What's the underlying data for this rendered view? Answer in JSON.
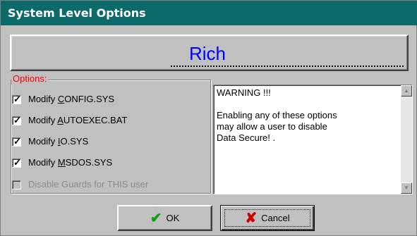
{
  "window": {
    "title": "System Level Options"
  },
  "user": {
    "name": "Rich"
  },
  "options": {
    "legend": "Options:",
    "items": [
      {
        "pre": "Modify ",
        "key": "C",
        "post": "ONFIG.SYS",
        "checked": true,
        "enabled": true
      },
      {
        "pre": "Modify ",
        "key": "A",
        "post": "UTOEXEC.BAT",
        "checked": true,
        "enabled": true
      },
      {
        "pre": "Modify ",
        "key": "I",
        "post": "O.SYS",
        "checked": true,
        "enabled": true
      },
      {
        "pre": "Modify ",
        "key": "M",
        "post": "SDOS.SYS",
        "checked": true,
        "enabled": true
      },
      {
        "pre": "Disable Guards for THIS user",
        "key": "",
        "post": "",
        "checked": false,
        "enabled": false
      }
    ]
  },
  "warning": {
    "text": "WARNING !!!\n\nEnabling any of these options\nmay allow a user to disable\nData Secure! ."
  },
  "buttons": {
    "ok": {
      "label": "OK",
      "icon": "check-icon"
    },
    "cancel": {
      "label": "Cancel",
      "icon": "x-icon"
    }
  },
  "colors": {
    "titlebar": "#0d6a6a",
    "name": "#0000ff",
    "legend": "#ff0000"
  }
}
